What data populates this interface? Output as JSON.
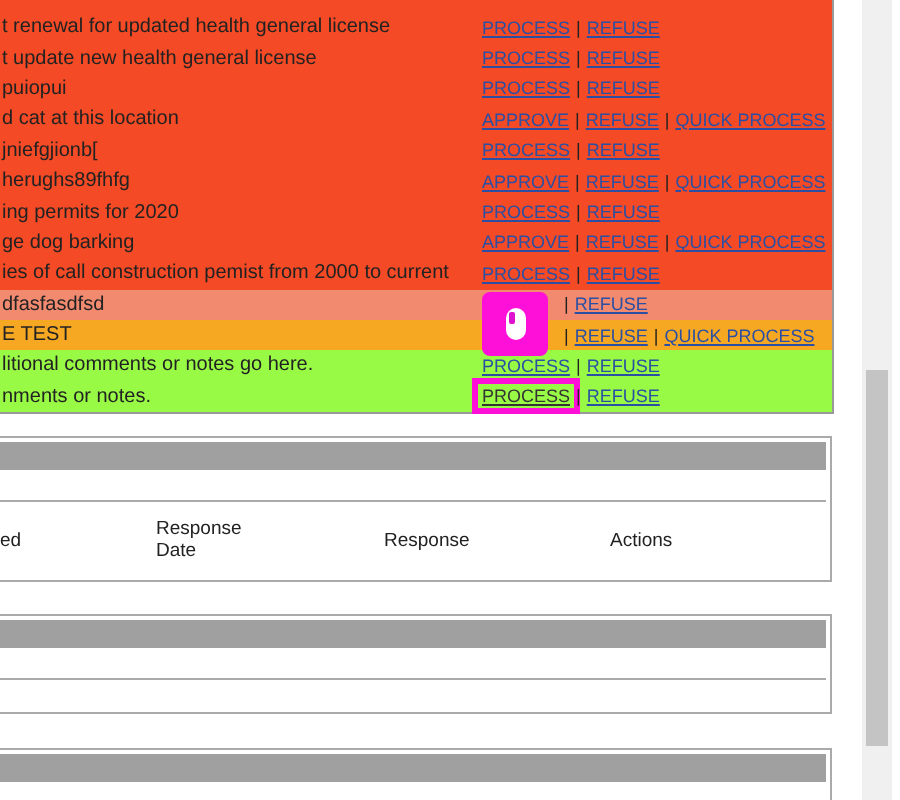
{
  "requests_table": {
    "rows": [
      {
        "description": "t renewal for updated health general license",
        "color": "#f44a25",
        "actions": [
          {
            "kind": "link",
            "label": "PROCESS",
            "highlighted": false
          },
          {
            "kind": "separator",
            "label": "|"
          },
          {
            "kind": "link",
            "label": "REFUSE",
            "highlighted": false
          }
        ]
      },
      {
        "description": "t update new health general license",
        "color": "#f44a25",
        "actions": [
          {
            "kind": "link",
            "label": "PROCESS",
            "highlighted": false
          },
          {
            "kind": "separator",
            "label": "|"
          },
          {
            "kind": "link",
            "label": "REFUSE",
            "highlighted": false
          }
        ]
      },
      {
        "description": "puiopui",
        "color": "#f44a25",
        "actions": [
          {
            "kind": "link",
            "label": "PROCESS",
            "highlighted": false
          },
          {
            "kind": "separator",
            "label": "|"
          },
          {
            "kind": "link",
            "label": "REFUSE",
            "highlighted": false
          }
        ]
      },
      {
        "description": "d cat at this location",
        "color": "#f44a25",
        "actions": [
          {
            "kind": "link",
            "label": "APPROVE",
            "highlighted": false
          },
          {
            "kind": "separator",
            "label": "|"
          },
          {
            "kind": "link",
            "label": "REFUSE",
            "highlighted": false
          },
          {
            "kind": "separator",
            "label": "|"
          },
          {
            "kind": "link",
            "label": "QUICK PROCESS",
            "highlighted": false
          }
        ]
      },
      {
        "description": "jniefgjionb[",
        "color": "#f44a25",
        "actions": [
          {
            "kind": "link",
            "label": "PROCESS",
            "highlighted": false
          },
          {
            "kind": "separator",
            "label": "|"
          },
          {
            "kind": "link",
            "label": "REFUSE",
            "highlighted": false
          }
        ]
      },
      {
        "description": "herughs89fhfg",
        "color": "#f44a25",
        "actions": [
          {
            "kind": "link",
            "label": "APPROVE",
            "highlighted": false
          },
          {
            "kind": "separator",
            "label": "|"
          },
          {
            "kind": "link",
            "label": "REFUSE",
            "highlighted": false
          },
          {
            "kind": "separator",
            "label": "|"
          },
          {
            "kind": "link",
            "label": "QUICK PROCESS",
            "highlighted": false
          }
        ]
      },
      {
        "description": "ing permits for 2020",
        "color": "#f44a25",
        "actions": [
          {
            "kind": "link",
            "label": "PROCESS",
            "highlighted": false
          },
          {
            "kind": "separator",
            "label": "|"
          },
          {
            "kind": "link",
            "label": "REFUSE",
            "highlighted": false
          }
        ]
      },
      {
        "description": "ge dog barking",
        "color": "#f44a25",
        "actions": [
          {
            "kind": "link",
            "label": "APPROVE",
            "highlighted": false
          },
          {
            "kind": "separator",
            "label": "|"
          },
          {
            "kind": "link",
            "label": "REFUSE",
            "highlighted": false
          },
          {
            "kind": "separator",
            "label": "|"
          },
          {
            "kind": "link",
            "label": "QUICK PROCESS",
            "highlighted": false
          }
        ]
      },
      {
        "description": "ies of call construction pemist from 2000 to current",
        "color": "#f44a25",
        "actions": [
          {
            "kind": "link",
            "label": "PROCESS",
            "highlighted": false
          },
          {
            "kind": "separator",
            "label": "|"
          },
          {
            "kind": "link",
            "label": "REFUSE",
            "highlighted": false
          }
        ]
      },
      {
        "description": "dfasfasdfsd",
        "color": "#f28a70",
        "actions": [
          {
            "kind": "covered"
          },
          {
            "kind": "separator",
            "label": "|"
          },
          {
            "kind": "link",
            "label": "REFUSE",
            "highlighted": false
          }
        ]
      },
      {
        "description": "E TEST",
        "color": "#f7a823",
        "actions": [
          {
            "kind": "covered"
          },
          {
            "kind": "separator",
            "label": "|"
          },
          {
            "kind": "link",
            "label": "REFUSE",
            "highlighted": false
          },
          {
            "kind": "separator",
            "label": "|"
          },
          {
            "kind": "link",
            "label": "QUICK PROCESS",
            "highlighted": false
          }
        ]
      },
      {
        "description": "litional comments or notes go here.",
        "color": "#99fa46",
        "actions": [
          {
            "kind": "link",
            "label": "PROCESS",
            "highlighted": false
          },
          {
            "kind": "separator",
            "label": "|"
          },
          {
            "kind": "link",
            "label": "REFUSE",
            "highlighted": false
          }
        ]
      },
      {
        "description": "nments or notes.",
        "color": "#99fa46",
        "actions": [
          {
            "kind": "link",
            "label": "PROCESS",
            "highlighted": true
          },
          {
            "kind": "separator",
            "label": "|"
          },
          {
            "kind": "link",
            "label": "REFUSE",
            "highlighted": false
          }
        ]
      }
    ]
  },
  "responses_table": {
    "columns": [
      "ed",
      "Response Date",
      "Response",
      "Actions"
    ]
  }
}
